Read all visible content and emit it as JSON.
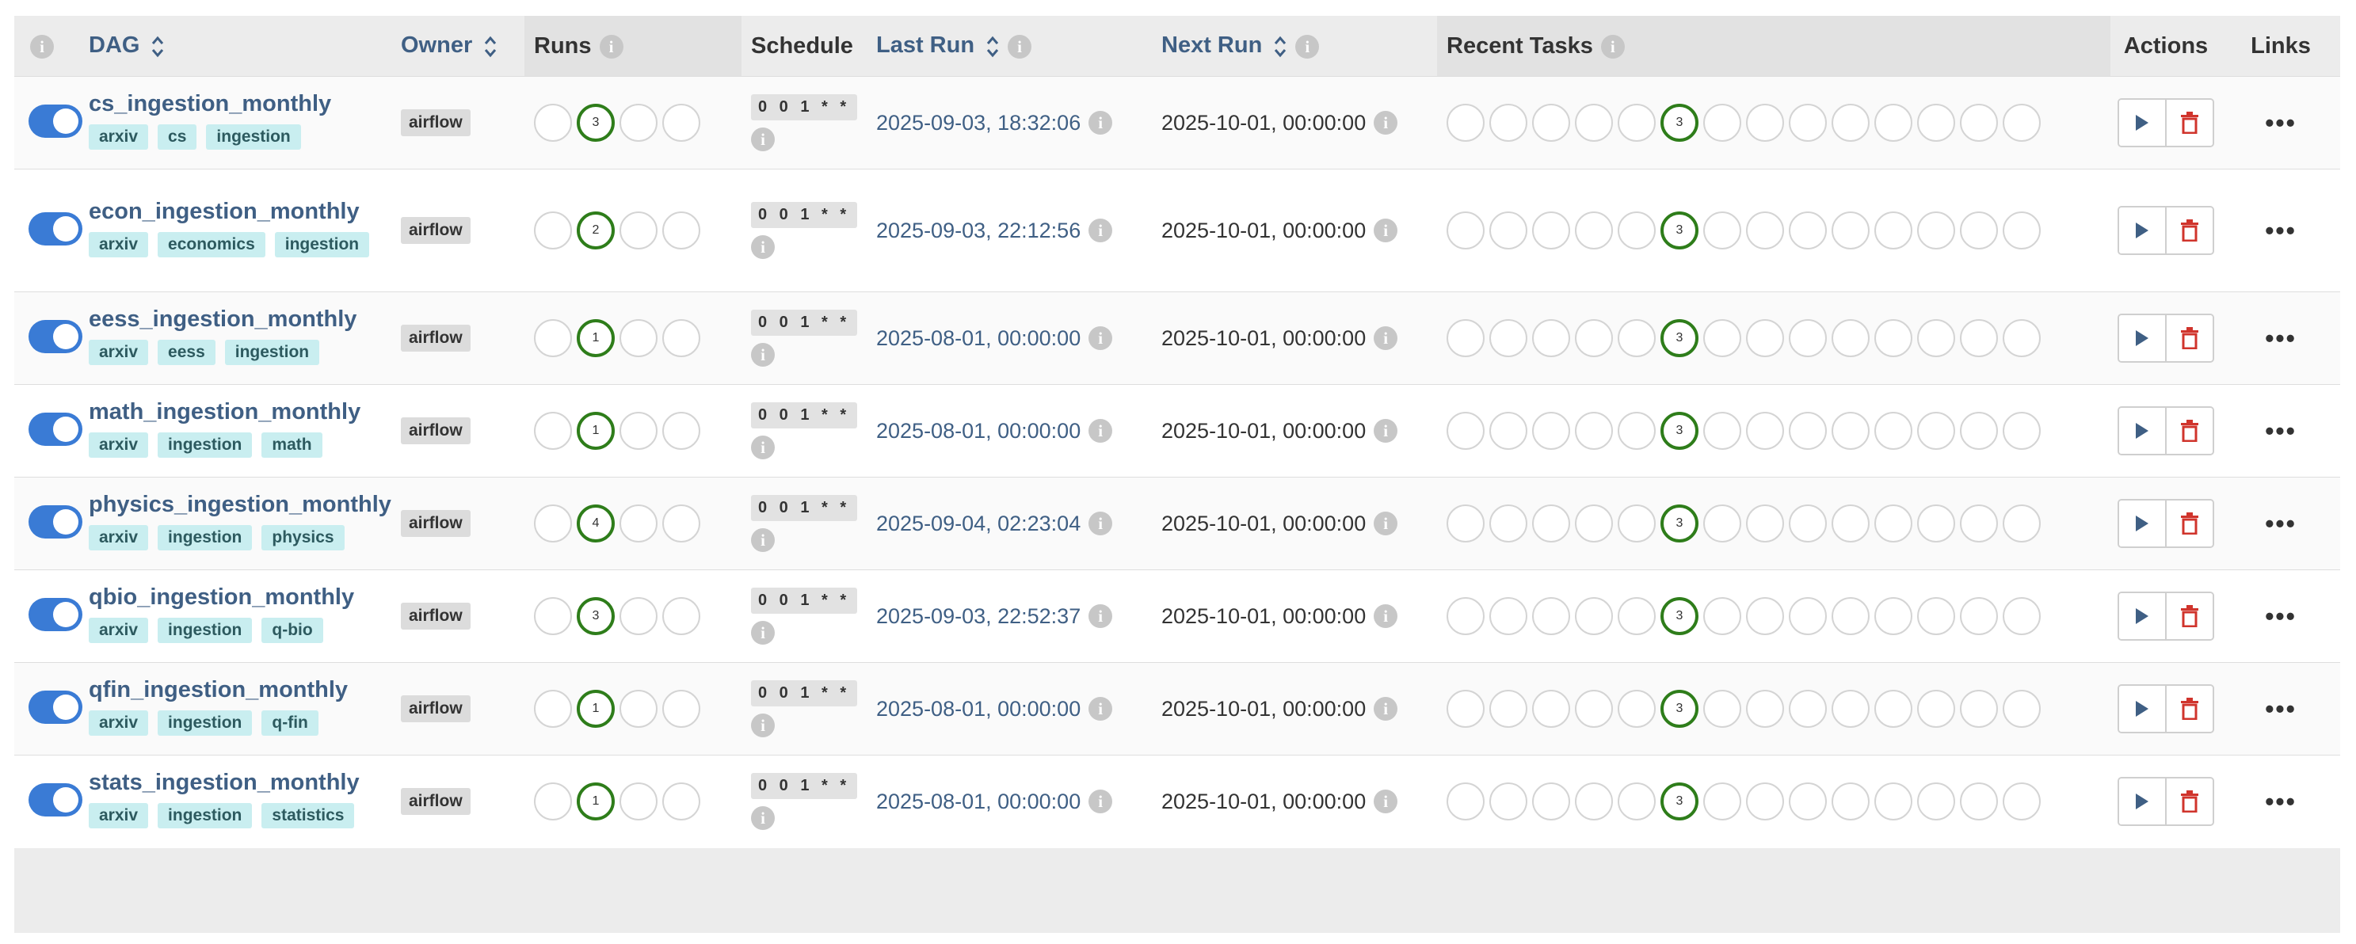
{
  "columns": {
    "dag": "DAG",
    "owner": "Owner",
    "runs": "Runs",
    "schedule": "Schedule",
    "last_run": "Last Run",
    "next_run": "Next Run",
    "recent_tasks": "Recent Tasks",
    "actions": "Actions",
    "links": "Links"
  },
  "info_glyph": "i",
  "colors": {
    "accent": "#3a7bd5",
    "success": "#2e7d1a",
    "danger": "#d0342c",
    "link": "#3f5f84",
    "tag_bg": "#c9eef0"
  },
  "icons": {
    "play": "play-icon",
    "delete": "trash-icon",
    "more": "more-icon",
    "info": "info-icon",
    "sort": "sort-icon"
  },
  "more_label": "•••",
  "dags": [
    {
      "name": "cs_ingestion_monthly",
      "tags": [
        "arxiv",
        "cs",
        "ingestion"
      ],
      "owner": "airflow",
      "runs_success": "3",
      "schedule": "0 0 1 * *",
      "last_run": "2025-09-03, 18:32:06",
      "next_run": "2025-10-01, 00:00:00",
      "recent_success": "3",
      "active": true
    },
    {
      "name": "econ_ingestion_monthly",
      "tags": [
        "arxiv",
        "economics",
        "ingestion"
      ],
      "owner": "airflow",
      "runs_success": "2",
      "schedule": "0 0 1 * *",
      "last_run": "2025-09-03, 22:12:56",
      "next_run": "2025-10-01, 00:00:00",
      "recent_success": "3",
      "active": true
    },
    {
      "name": "eess_ingestion_monthly",
      "tags": [
        "arxiv",
        "eess",
        "ingestion"
      ],
      "owner": "airflow",
      "runs_success": "1",
      "schedule": "0 0 1 * *",
      "last_run": "2025-08-01, 00:00:00",
      "next_run": "2025-10-01, 00:00:00",
      "recent_success": "3",
      "active": true
    },
    {
      "name": "math_ingestion_monthly",
      "tags": [
        "arxiv",
        "ingestion",
        "math"
      ],
      "owner": "airflow",
      "runs_success": "1",
      "schedule": "0 0 1 * *",
      "last_run": "2025-08-01, 00:00:00",
      "next_run": "2025-10-01, 00:00:00",
      "recent_success": "3",
      "active": true
    },
    {
      "name": "physics_ingestion_monthly",
      "tags": [
        "arxiv",
        "ingestion",
        "physics"
      ],
      "owner": "airflow",
      "runs_success": "4",
      "schedule": "0 0 1 * *",
      "last_run": "2025-09-04, 02:23:04",
      "next_run": "2025-10-01, 00:00:00",
      "recent_success": "3",
      "active": true
    },
    {
      "name": "qbio_ingestion_monthly",
      "tags": [
        "arxiv",
        "ingestion",
        "q-bio"
      ],
      "owner": "airflow",
      "runs_success": "3",
      "schedule": "0 0 1 * *",
      "last_run": "2025-09-03, 22:52:37",
      "next_run": "2025-10-01, 00:00:00",
      "recent_success": "3",
      "active": true
    },
    {
      "name": "qfin_ingestion_monthly",
      "tags": [
        "arxiv",
        "ingestion",
        "q-fin"
      ],
      "owner": "airflow",
      "runs_success": "1",
      "schedule": "0 0 1 * *",
      "last_run": "2025-08-01, 00:00:00",
      "next_run": "2025-10-01, 00:00:00",
      "recent_success": "3",
      "active": true
    },
    {
      "name": "stats_ingestion_monthly",
      "tags": [
        "arxiv",
        "ingestion",
        "statistics"
      ],
      "owner": "airflow",
      "runs_success": "1",
      "schedule": "0 0 1 * *",
      "last_run": "2025-08-01, 00:00:00",
      "next_run": "2025-10-01, 00:00:00",
      "recent_success": "3",
      "active": true
    }
  ]
}
